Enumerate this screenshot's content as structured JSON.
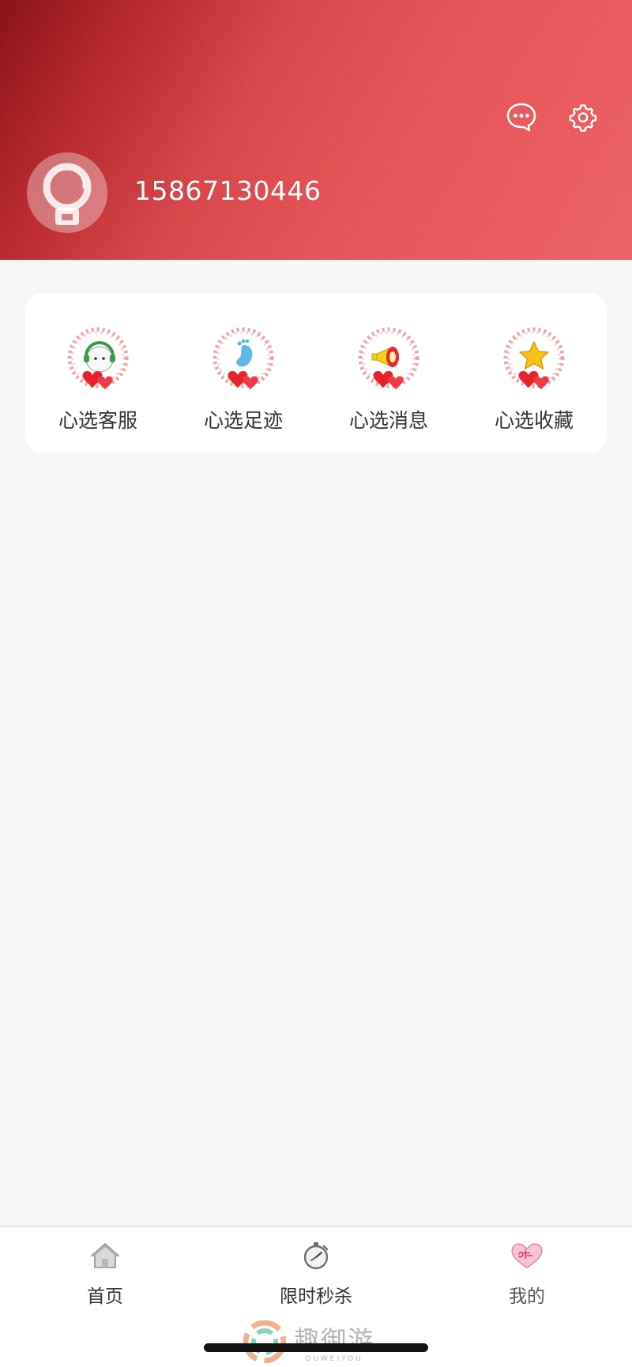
{
  "header": {
    "phone": "15867130446",
    "icons": {
      "message": "chat-bubble-icon",
      "settings": "gear-icon",
      "avatar": "avatar-icon"
    }
  },
  "services": [
    {
      "label": "心选客服",
      "icon": "headset-bunny-icon"
    },
    {
      "label": "心选足迹",
      "icon": "footprint-icon"
    },
    {
      "label": "心选消息",
      "icon": "megaphone-icon"
    },
    {
      "label": "心选收藏",
      "icon": "star-icon"
    }
  ],
  "tabbar": {
    "tabs": [
      {
        "label": "首页",
        "icon": "home-icon"
      },
      {
        "label": "限时秒杀",
        "icon": "stopwatch-icon"
      },
      {
        "label": "我的",
        "icon": "heart-logo-icon"
      }
    ],
    "active_index": 2
  },
  "watermark": {
    "text": "趣御游",
    "subtext": "QUWEIYOU"
  },
  "colors": {
    "header_dark": "#8a0f13",
    "header_light": "#f06266",
    "page_bg": "#f6f6f6",
    "card_bg": "#ffffff"
  }
}
